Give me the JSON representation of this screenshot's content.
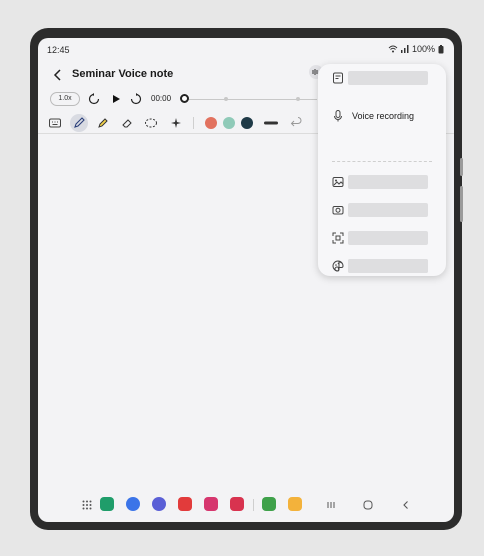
{
  "status_bar": {
    "time": "12:45",
    "battery": "100%"
  },
  "app_bar": {
    "title": "Seminar Voice note"
  },
  "player": {
    "speed": "1.0x",
    "time": "00:00",
    "progress": 0.0
  },
  "toolbar": {
    "colors": [
      "#e2725f",
      "#8fcab8",
      "#1f3a47"
    ]
  },
  "menu": {
    "voice_recording_label": "Voice recording",
    "items": [
      {
        "icon": "note-file-icon",
        "label": ""
      },
      {
        "icon": "microphone-icon",
        "label": "Voice recording"
      },
      {
        "icon": "image-icon",
        "label": ""
      },
      {
        "icon": "camera-icon",
        "label": ""
      },
      {
        "icon": "scan-icon",
        "label": ""
      },
      {
        "icon": "music-note-icon",
        "label": ""
      },
      {
        "icon": "palette-icon",
        "label": ""
      }
    ]
  },
  "taskbar": {
    "apps": [
      {
        "name": "phone-app",
        "color": "#1f9d6a"
      },
      {
        "name": "messages-app",
        "color": "#3b74e8"
      },
      {
        "name": "internet-app",
        "color": "#5a5fd6"
      },
      {
        "name": "notes-app",
        "color": "#e23b3b"
      },
      {
        "name": "flower-app",
        "color": "#d6366e"
      },
      {
        "name": "camera-app",
        "color": "#d8334f"
      },
      {
        "name": "calculator-app",
        "color": "#3fa14a"
      },
      {
        "name": "files-app",
        "color": "#f3b23b"
      }
    ]
  }
}
